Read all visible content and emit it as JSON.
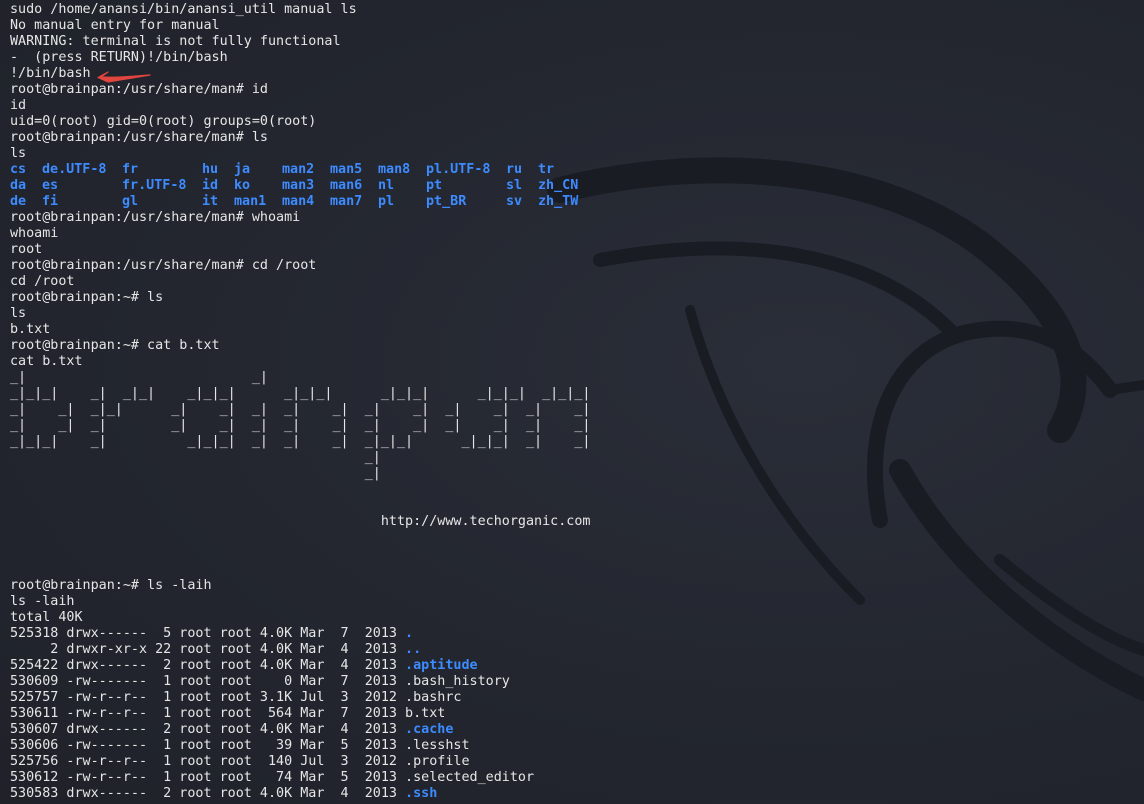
{
  "watermark_icon": "dragon-logo-icon",
  "accent_blue": "#3d8bff",
  "annotation_color": "#e0463f",
  "lines": [
    "sudo /home/anansi/bin/anansi_util manual ls",
    "No manual entry for manual",
    "WARNING: terminal is not fully functional",
    "-  (press RETURN)!/bin/bash",
    "!/bin/bash",
    "root@brainpan:/usr/share/man# id",
    "id",
    "uid=0(root) gid=0(root) groups=0(root)",
    "root@brainpan:/usr/share/man# ls",
    "ls"
  ],
  "ls_grid": [
    [
      "cs",
      "de.UTF-8",
      "fr",
      "hu",
      "ja",
      "man2",
      "man5",
      "man8",
      "pl.UTF-8",
      "ru",
      "tr"
    ],
    [
      "da",
      "es",
      "fr.UTF-8",
      "id",
      "ko",
      "man3",
      "man6",
      "nl",
      "pt",
      "sl",
      "zh_CN"
    ],
    [
      "de",
      "fi",
      "gl",
      "it",
      "man1",
      "man4",
      "man7",
      "pl",
      "pt_BR",
      "sv",
      "zh_TW"
    ]
  ],
  "lines2": [
    "root@brainpan:/usr/share/man# whoami",
    "whoami",
    "root",
    "root@brainpan:/usr/share/man# cd /root",
    "cd /root",
    "root@brainpan:~# ls",
    "ls",
    "b.txt",
    "root@brainpan:~# cat b.txt",
    "cat b.txt"
  ],
  "banner": [
    "_|                            _|",
    "_|_|_|    _|  _|_|    _|_|_|      _|_|_|      _|_|_|      _|_|_|  _|_|_|",
    "_|    _|  _|_|      _|    _|  _|  _|    _|  _|    _|  _|    _|  _|    _|",
    "_|    _|  _|        _|    _|  _|  _|    _|  _|    _|  _|    _|  _|    _|",
    "_|_|_|    _|          _|_|_|  _|  _|    _|  _|_|_|      _|_|_|  _|    _|",
    "                                            _|",
    "                                            _|"
  ],
  "banner_blank": "",
  "url_line": "                                              http://www.techorganic.com",
  "lines3": [
    "root@brainpan:~# ls -laih",
    "ls -laih",
    "total 40K"
  ],
  "listing": [
    {
      "prefix": "525318 drwx------  5 root root 4.0K Mar  7  2013 ",
      "name": ".",
      "dir": true
    },
    {
      "prefix": "     2 drwxr-xr-x 22 root root 4.0K Mar  4  2013 ",
      "name": "..",
      "dir": true
    },
    {
      "prefix": "525422 drwx------  2 root root 4.0K Mar  4  2013 ",
      "name": ".aptitude",
      "dir": true
    },
    {
      "prefix": "530609 -rw-------  1 root root    0 Mar  7  2013 ",
      "name": ".bash_history",
      "dir": false
    },
    {
      "prefix": "525757 -rw-r--r--  1 root root 3.1K Jul  3  2012 ",
      "name": ".bashrc",
      "dir": false
    },
    {
      "prefix": "530611 -rw-r--r--  1 root root  564 Mar  7  2013 ",
      "name": "b.txt",
      "dir": false
    },
    {
      "prefix": "530607 drwx------  2 root root 4.0K Mar  4  2013 ",
      "name": ".cache",
      "dir": true
    },
    {
      "prefix": "530606 -rw-------  1 root root   39 Mar  5  2013 ",
      "name": ".lesshst",
      "dir": false
    },
    {
      "prefix": "525756 -rw-r--r--  1 root root  140 Jul  3  2012 ",
      "name": ".profile",
      "dir": false
    },
    {
      "prefix": "530612 -rw-r--r--  1 root root   74 Mar  5  2013 ",
      "name": ".selected_editor",
      "dir": false
    },
    {
      "prefix": "530583 drwx------  2 root root 4.0K Mar  4  2013 ",
      "name": ".ssh",
      "dir": true
    }
  ]
}
